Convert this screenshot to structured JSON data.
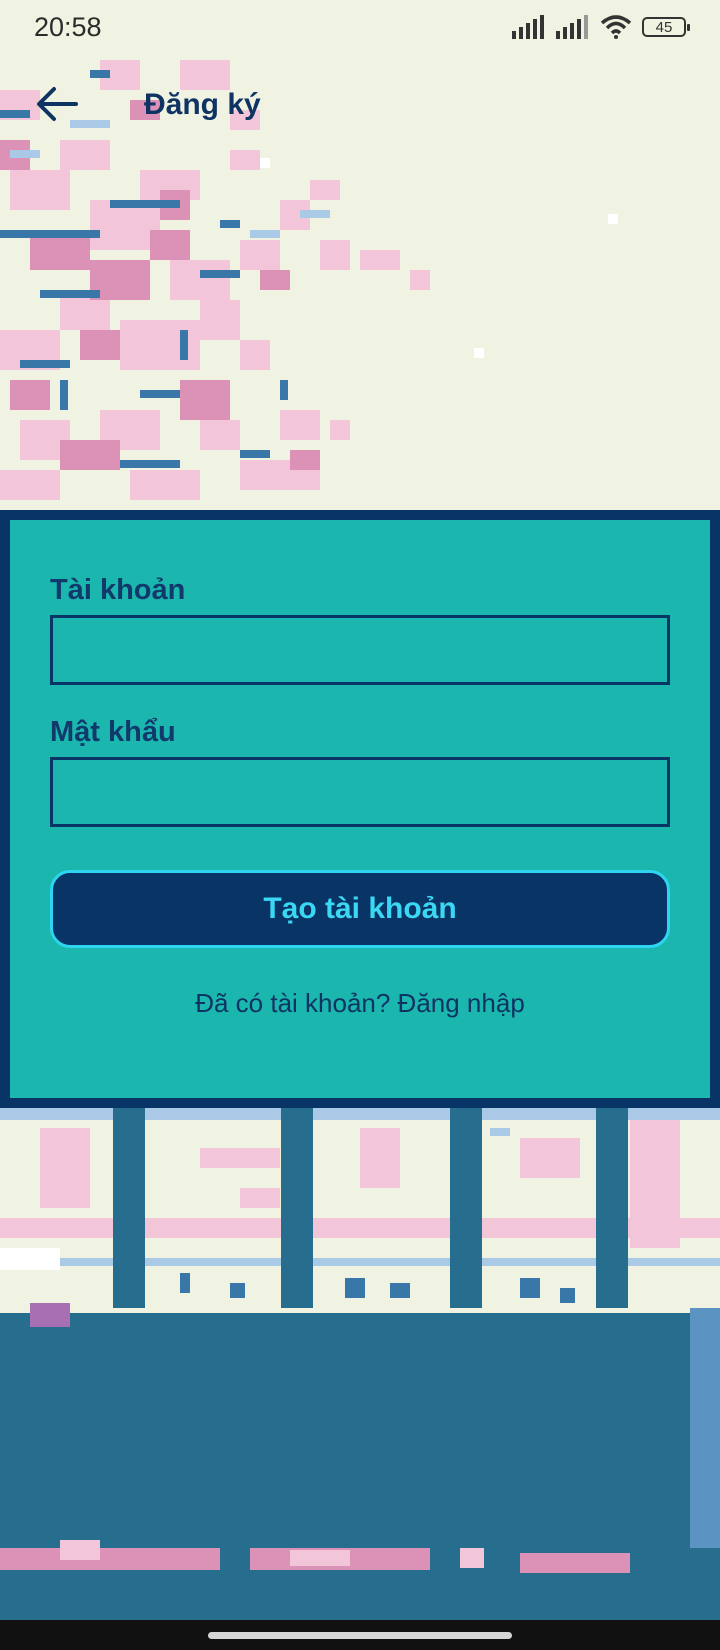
{
  "status_bar": {
    "time": "20:58",
    "battery": "45"
  },
  "app_bar": {
    "title": "Đăng ký",
    "back_icon": "arrow-left-icon"
  },
  "form": {
    "username_label": "Tài khoản",
    "username_value": "",
    "password_label": "Mật khẩu",
    "password_value": "",
    "create_button_label": "Tạo tài khoản",
    "login_link_label": "Đã có tài khoản? Đăng nhập"
  },
  "colors": {
    "panel_bg": "#1bb7ae",
    "panel_border": "#083466",
    "button_bg": "#083466",
    "button_text": "#3ad8f2",
    "label_text": "#11396b",
    "background": "#f0f2e2"
  }
}
